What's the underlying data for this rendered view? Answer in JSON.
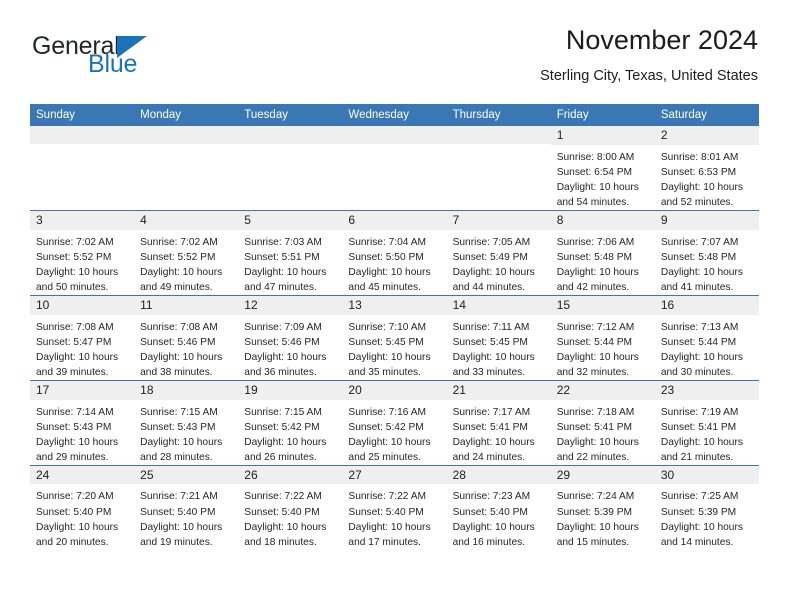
{
  "brand": {
    "name_top": "General",
    "name_bottom": "Blue",
    "triangle_color": "#1c72bb"
  },
  "header": {
    "title": "November 2024",
    "subtitle": "Sterling City, Texas, United States"
  },
  "theme": {
    "header_blue": "#3a77b5",
    "daynum_gray": "#efefef"
  },
  "weekdays": [
    "Sunday",
    "Monday",
    "Tuesday",
    "Wednesday",
    "Thursday",
    "Friday",
    "Saturday"
  ],
  "weeks": [
    [
      {
        "day": "",
        "sunrise": "",
        "sunset": "",
        "daylight": "",
        "daylight2": "",
        "empty": true
      },
      {
        "day": "",
        "sunrise": "",
        "sunset": "",
        "daylight": "",
        "daylight2": "",
        "empty": true
      },
      {
        "day": "",
        "sunrise": "",
        "sunset": "",
        "daylight": "",
        "daylight2": "",
        "empty": true
      },
      {
        "day": "",
        "sunrise": "",
        "sunset": "",
        "daylight": "",
        "daylight2": "",
        "empty": true
      },
      {
        "day": "",
        "sunrise": "",
        "sunset": "",
        "daylight": "",
        "daylight2": "",
        "empty": true
      },
      {
        "day": "1",
        "sunrise": "Sunrise: 8:00 AM",
        "sunset": "Sunset: 6:54 PM",
        "daylight": "Daylight: 10 hours",
        "daylight2": "and 54 minutes.",
        "empty": false
      },
      {
        "day": "2",
        "sunrise": "Sunrise: 8:01 AM",
        "sunset": "Sunset: 6:53 PM",
        "daylight": "Daylight: 10 hours",
        "daylight2": "and 52 minutes.",
        "empty": false
      }
    ],
    [
      {
        "day": "3",
        "sunrise": "Sunrise: 7:02 AM",
        "sunset": "Sunset: 5:52 PM",
        "daylight": "Daylight: 10 hours",
        "daylight2": "and 50 minutes.",
        "empty": false
      },
      {
        "day": "4",
        "sunrise": "Sunrise: 7:02 AM",
        "sunset": "Sunset: 5:52 PM",
        "daylight": "Daylight: 10 hours",
        "daylight2": "and 49 minutes.",
        "empty": false
      },
      {
        "day": "5",
        "sunrise": "Sunrise: 7:03 AM",
        "sunset": "Sunset: 5:51 PM",
        "daylight": "Daylight: 10 hours",
        "daylight2": "and 47 minutes.",
        "empty": false
      },
      {
        "day": "6",
        "sunrise": "Sunrise: 7:04 AM",
        "sunset": "Sunset: 5:50 PM",
        "daylight": "Daylight: 10 hours",
        "daylight2": "and 45 minutes.",
        "empty": false
      },
      {
        "day": "7",
        "sunrise": "Sunrise: 7:05 AM",
        "sunset": "Sunset: 5:49 PM",
        "daylight": "Daylight: 10 hours",
        "daylight2": "and 44 minutes.",
        "empty": false
      },
      {
        "day": "8",
        "sunrise": "Sunrise: 7:06 AM",
        "sunset": "Sunset: 5:48 PM",
        "daylight": "Daylight: 10 hours",
        "daylight2": "and 42 minutes.",
        "empty": false
      },
      {
        "day": "9",
        "sunrise": "Sunrise: 7:07 AM",
        "sunset": "Sunset: 5:48 PM",
        "daylight": "Daylight: 10 hours",
        "daylight2": "and 41 minutes.",
        "empty": false
      }
    ],
    [
      {
        "day": "10",
        "sunrise": "Sunrise: 7:08 AM",
        "sunset": "Sunset: 5:47 PM",
        "daylight": "Daylight: 10 hours",
        "daylight2": "and 39 minutes.",
        "empty": false
      },
      {
        "day": "11",
        "sunrise": "Sunrise: 7:08 AM",
        "sunset": "Sunset: 5:46 PM",
        "daylight": "Daylight: 10 hours",
        "daylight2": "and 38 minutes.",
        "empty": false
      },
      {
        "day": "12",
        "sunrise": "Sunrise: 7:09 AM",
        "sunset": "Sunset: 5:46 PM",
        "daylight": "Daylight: 10 hours",
        "daylight2": "and 36 minutes.",
        "empty": false
      },
      {
        "day": "13",
        "sunrise": "Sunrise: 7:10 AM",
        "sunset": "Sunset: 5:45 PM",
        "daylight": "Daylight: 10 hours",
        "daylight2": "and 35 minutes.",
        "empty": false
      },
      {
        "day": "14",
        "sunrise": "Sunrise: 7:11 AM",
        "sunset": "Sunset: 5:45 PM",
        "daylight": "Daylight: 10 hours",
        "daylight2": "and 33 minutes.",
        "empty": false
      },
      {
        "day": "15",
        "sunrise": "Sunrise: 7:12 AM",
        "sunset": "Sunset: 5:44 PM",
        "daylight": "Daylight: 10 hours",
        "daylight2": "and 32 minutes.",
        "empty": false
      },
      {
        "day": "16",
        "sunrise": "Sunrise: 7:13 AM",
        "sunset": "Sunset: 5:44 PM",
        "daylight": "Daylight: 10 hours",
        "daylight2": "and 30 minutes.",
        "empty": false
      }
    ],
    [
      {
        "day": "17",
        "sunrise": "Sunrise: 7:14 AM",
        "sunset": "Sunset: 5:43 PM",
        "daylight": "Daylight: 10 hours",
        "daylight2": "and 29 minutes.",
        "empty": false
      },
      {
        "day": "18",
        "sunrise": "Sunrise: 7:15 AM",
        "sunset": "Sunset: 5:43 PM",
        "daylight": "Daylight: 10 hours",
        "daylight2": "and 28 minutes.",
        "empty": false
      },
      {
        "day": "19",
        "sunrise": "Sunrise: 7:15 AM",
        "sunset": "Sunset: 5:42 PM",
        "daylight": "Daylight: 10 hours",
        "daylight2": "and 26 minutes.",
        "empty": false
      },
      {
        "day": "20",
        "sunrise": "Sunrise: 7:16 AM",
        "sunset": "Sunset: 5:42 PM",
        "daylight": "Daylight: 10 hours",
        "daylight2": "and 25 minutes.",
        "empty": false
      },
      {
        "day": "21",
        "sunrise": "Sunrise: 7:17 AM",
        "sunset": "Sunset: 5:41 PM",
        "daylight": "Daylight: 10 hours",
        "daylight2": "and 24 minutes.",
        "empty": false
      },
      {
        "day": "22",
        "sunrise": "Sunrise: 7:18 AM",
        "sunset": "Sunset: 5:41 PM",
        "daylight": "Daylight: 10 hours",
        "daylight2": "and 22 minutes.",
        "empty": false
      },
      {
        "day": "23",
        "sunrise": "Sunrise: 7:19 AM",
        "sunset": "Sunset: 5:41 PM",
        "daylight": "Daylight: 10 hours",
        "daylight2": "and 21 minutes.",
        "empty": false
      }
    ],
    [
      {
        "day": "24",
        "sunrise": "Sunrise: 7:20 AM",
        "sunset": "Sunset: 5:40 PM",
        "daylight": "Daylight: 10 hours",
        "daylight2": "and 20 minutes.",
        "empty": false
      },
      {
        "day": "25",
        "sunrise": "Sunrise: 7:21 AM",
        "sunset": "Sunset: 5:40 PM",
        "daylight": "Daylight: 10 hours",
        "daylight2": "and 19 minutes.",
        "empty": false
      },
      {
        "day": "26",
        "sunrise": "Sunrise: 7:22 AM",
        "sunset": "Sunset: 5:40 PM",
        "daylight": "Daylight: 10 hours",
        "daylight2": "and 18 minutes.",
        "empty": false
      },
      {
        "day": "27",
        "sunrise": "Sunrise: 7:22 AM",
        "sunset": "Sunset: 5:40 PM",
        "daylight": "Daylight: 10 hours",
        "daylight2": "and 17 minutes.",
        "empty": false
      },
      {
        "day": "28",
        "sunrise": "Sunrise: 7:23 AM",
        "sunset": "Sunset: 5:40 PM",
        "daylight": "Daylight: 10 hours",
        "daylight2": "and 16 minutes.",
        "empty": false
      },
      {
        "day": "29",
        "sunrise": "Sunrise: 7:24 AM",
        "sunset": "Sunset: 5:39 PM",
        "daylight": "Daylight: 10 hours",
        "daylight2": "and 15 minutes.",
        "empty": false
      },
      {
        "day": "30",
        "sunrise": "Sunrise: 7:25 AM",
        "sunset": "Sunset: 5:39 PM",
        "daylight": "Daylight: 10 hours",
        "daylight2": "and 14 minutes.",
        "empty": false
      }
    ]
  ]
}
